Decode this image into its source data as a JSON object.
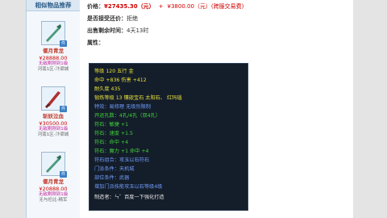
{
  "sidebar": {
    "title": "相似物品推荐",
    "items": [
      {
        "name": "偃月青龙",
        "price": "¥28888.00",
        "tag": "无敌刚刚到1级",
        "server": "河南1区-汴梁城"
      },
      {
        "name": "斩妖泣血",
        "price": "¥30500.00",
        "tag": "无敌刚刚到1级",
        "server": "河南1区-汴梁城"
      },
      {
        "name": "偃月青龙",
        "price": "¥20888.00",
        "tag": "无敌刚刚到1级",
        "server": "无与伦比-精军"
      }
    ]
  },
  "detail": {
    "price_label": "价格：",
    "price_main": "¥27435.30（元）",
    "price_plus": "+",
    "price_alt": "¥3800.00（元）",
    "price_note": "(跨服交易费)",
    "bargain_label": "是否接受还价：",
    "bargain_value": "拒绝",
    "time_label": "出售剩余时间：",
    "time_value": "4天13时",
    "attr_label": "属性："
  },
  "stats": [
    {
      "text": "等级 120 五行 金",
      "color": "y"
    },
    {
      "text": "命中 +836 伤害 +412",
      "color": "y"
    },
    {
      "text": "耐久度 435",
      "color": "y"
    },
    {
      "text": "锻炼等级 13 镶嵌宝石 太阳石、 红玛瑙",
      "color": "y"
    },
    {
      "text": "特效：易修理 无级别限制",
      "color": "b"
    },
    {
      "text": "开运孔数：4孔/4孔（双4孔）",
      "color": "g"
    },
    {
      "text": "符石：敏捷 +1",
      "color": "g"
    },
    {
      "text": "符石：速度 +1.5",
      "color": "g"
    },
    {
      "text": "符石：命中 +4",
      "color": "g"
    },
    {
      "text": "符石：魔力 +1 命中 +4",
      "color": "g"
    },
    {
      "text": "符石组合：攻玉以石符石",
      "color": "b"
    },
    {
      "text": "门派条件：天机城",
      "color": "b"
    },
    {
      "text": "部位条件：武器",
      "color": "b"
    },
    {
      "text": "增加门派技能攻玉以石等级4级",
      "color": "b"
    },
    {
      "text": "制造者：ㄣ゛百度一下强化打造",
      "color": "w"
    }
  ]
}
